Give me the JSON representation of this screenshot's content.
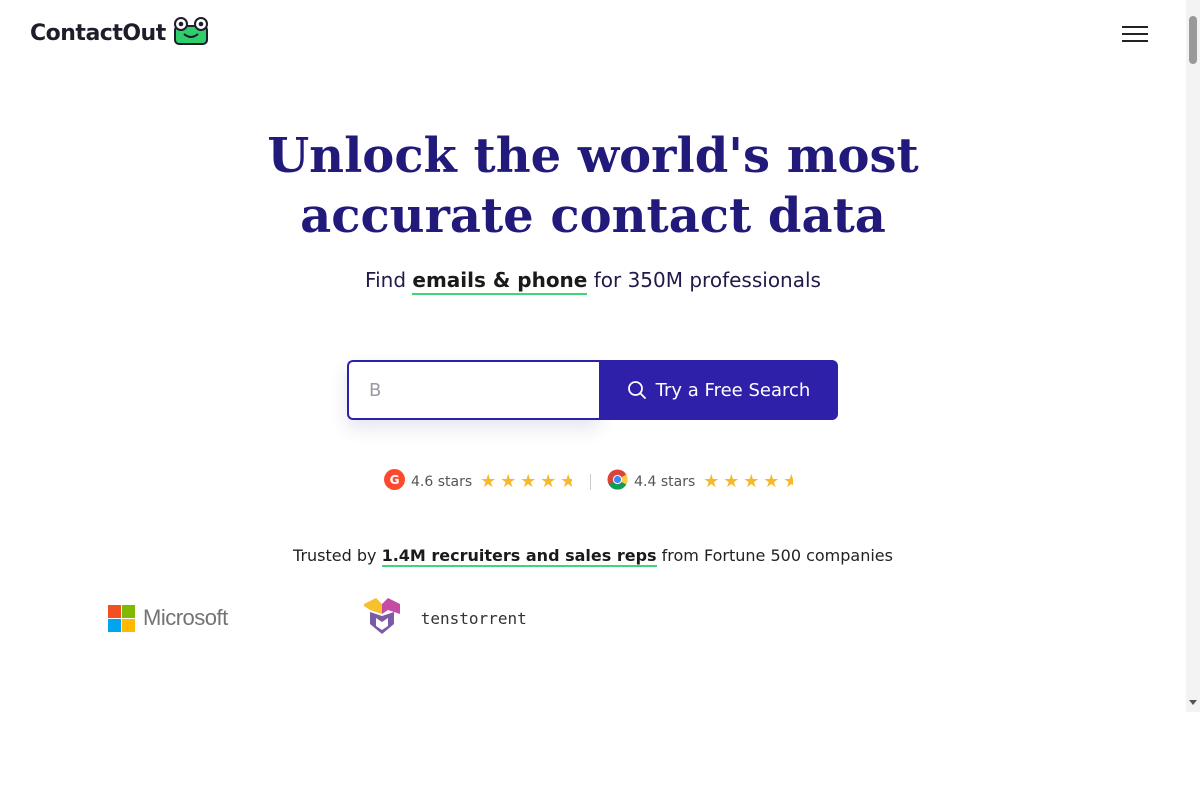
{
  "header": {
    "logo_text": "ContactOut",
    "menu_icon": "hamburger-menu-icon"
  },
  "hero": {
    "title_line1": "Unlock the world's most",
    "title_line2": "accurate contact data",
    "subtitle_prefix": "Find ",
    "subtitle_highlight": "emails & phone",
    "subtitle_suffix": " for 350M professionals"
  },
  "search": {
    "placeholder": "B",
    "button_label": "Try a Free Search",
    "button_icon": "search-icon"
  },
  "ratings": [
    {
      "source_icon": "g2-icon",
      "label": "4.6 stars",
      "value": 4.6
    },
    {
      "source_icon": "chrome-icon",
      "label": "4.4 stars",
      "value": 4.4
    }
  ],
  "trusted": {
    "prefix": "Trusted by ",
    "highlight": "1.4M recruiters and sales reps",
    "suffix": " from Fortune 500 companies"
  },
  "companies": [
    {
      "name": "Microsoft"
    },
    {
      "name": "tenstorrent"
    }
  ],
  "colors": {
    "brand_primary": "#2e20a8",
    "title": "#221a7a",
    "underline_accent": "#3fd67a",
    "star": "#f6b92d"
  }
}
